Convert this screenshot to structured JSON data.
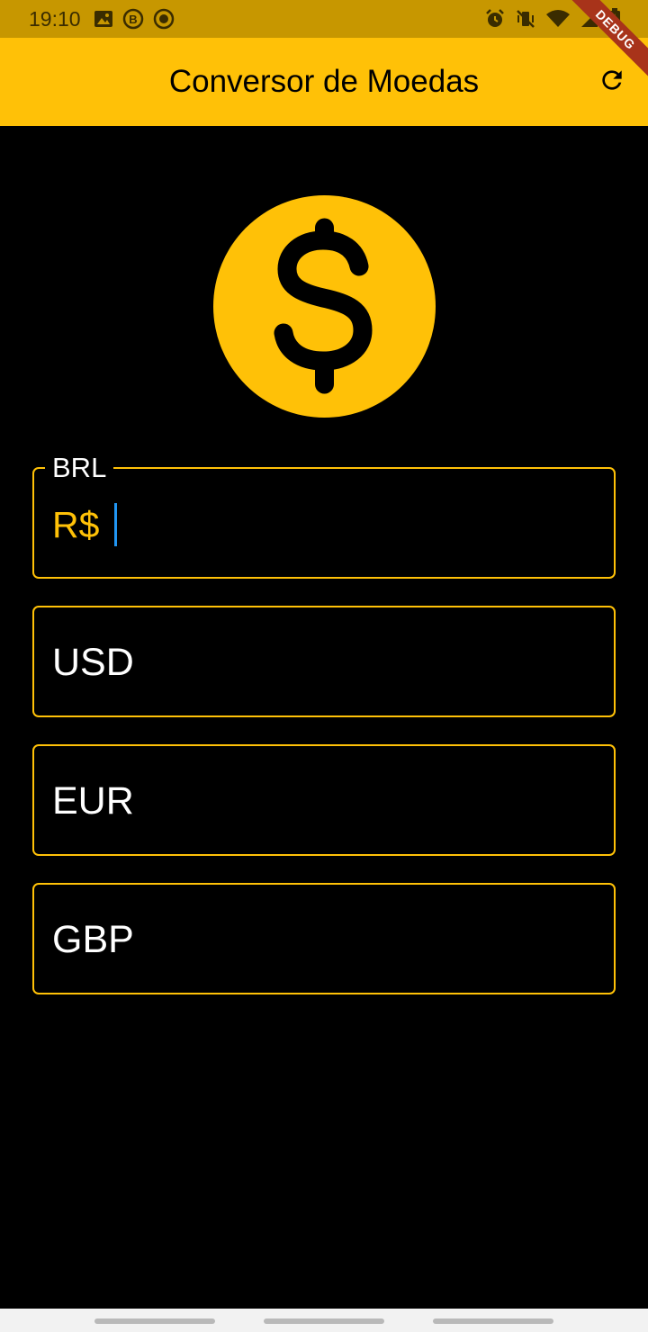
{
  "status_bar": {
    "time": "19:10",
    "left_icons": [
      "image-icon",
      "b-badge-icon",
      "target-icon"
    ],
    "right_icons": [
      "alarm-icon",
      "vibrate-off-icon",
      "wifi-icon",
      "signal-icon",
      "battery-charging-icon"
    ]
  },
  "app_bar": {
    "title": "Conversor de Moedas",
    "refresh_icon": "refresh-icon",
    "debug_label": "DEBUG"
  },
  "coin_icon": "dollar-coin-icon",
  "fields": {
    "brl": {
      "label": "BRL",
      "prefix": "R$",
      "value": ""
    },
    "usd": {
      "placeholder": "USD"
    },
    "eur": {
      "placeholder": "EUR"
    },
    "gbp": {
      "placeholder": "GBP"
    }
  },
  "colors": {
    "accent": "#ffc107",
    "status_bar": "#c79700",
    "background": "#000000",
    "cursor": "#2196f3",
    "debug_ribbon": "#a8331a"
  }
}
